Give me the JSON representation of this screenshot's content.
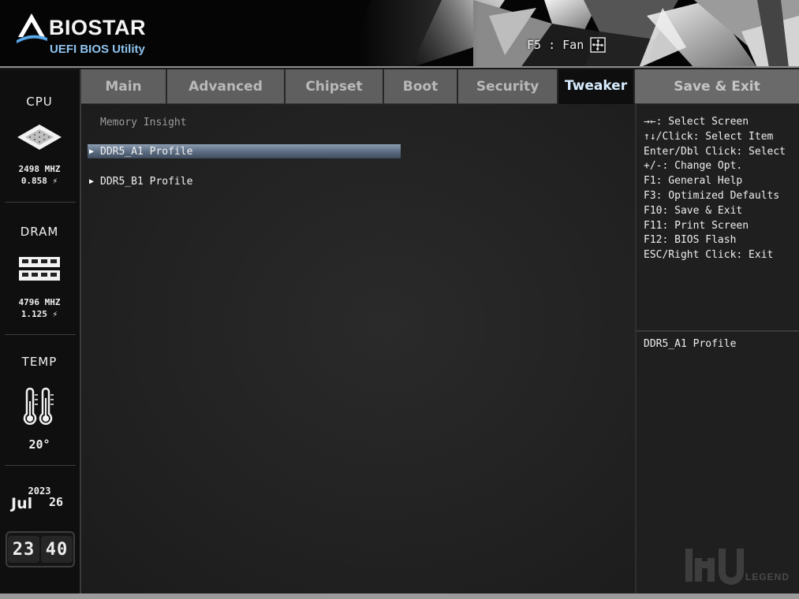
{
  "header": {
    "brand": "BIOSTAR",
    "subtitle": "UEFI BIOS Utility",
    "fan_hint": "F5 : Fan"
  },
  "status": {
    "cpu": {
      "title": "CPU",
      "frequency": "2498 MHZ",
      "voltage": "0.858 ⚡"
    },
    "dram": {
      "title": "DRAM",
      "frequency": "4796 MHZ",
      "voltage": "1.125 ⚡"
    },
    "temp": {
      "title": "TEMP",
      "value": "20°"
    },
    "date": {
      "year": "2023",
      "month": "Jul",
      "day": "26"
    },
    "clock": {
      "hours": "23",
      "minutes": "40"
    }
  },
  "tabs": [
    {
      "label": "Main",
      "active": false
    },
    {
      "label": "Advanced",
      "active": false
    },
    {
      "label": "Chipset",
      "active": false
    },
    {
      "label": "Boot",
      "active": false
    },
    {
      "label": "Security",
      "active": false
    },
    {
      "label": "Tweaker",
      "active": true
    },
    {
      "label": "Save & Exit",
      "active": false
    }
  ],
  "main": {
    "section_label": "Memory Insight",
    "items": [
      {
        "label": "DDR5_A1 Profile",
        "selected": true
      },
      {
        "label": "DDR5_B1 Profile",
        "selected": false
      }
    ]
  },
  "help": {
    "keys": [
      "→←: Select Screen",
      "↑↓/Click: Select Item",
      "Enter/Dbl Click: Select",
      "+/-: Change Opt.",
      "F1: General Help",
      "F3: Optimized Defaults",
      "F10: Save & Exit",
      "F11: Print Screen",
      "F12: BIOS Flash",
      "ESC/Right Click: Exit"
    ],
    "item_description": "DDR5_A1 Profile"
  },
  "watermark": {
    "text": "LEGEND"
  },
  "colors": {
    "selected_bar": "#5e6f85",
    "active_tab_text": "#d7ebff",
    "brand_subtitle": "#8fc3ee"
  }
}
